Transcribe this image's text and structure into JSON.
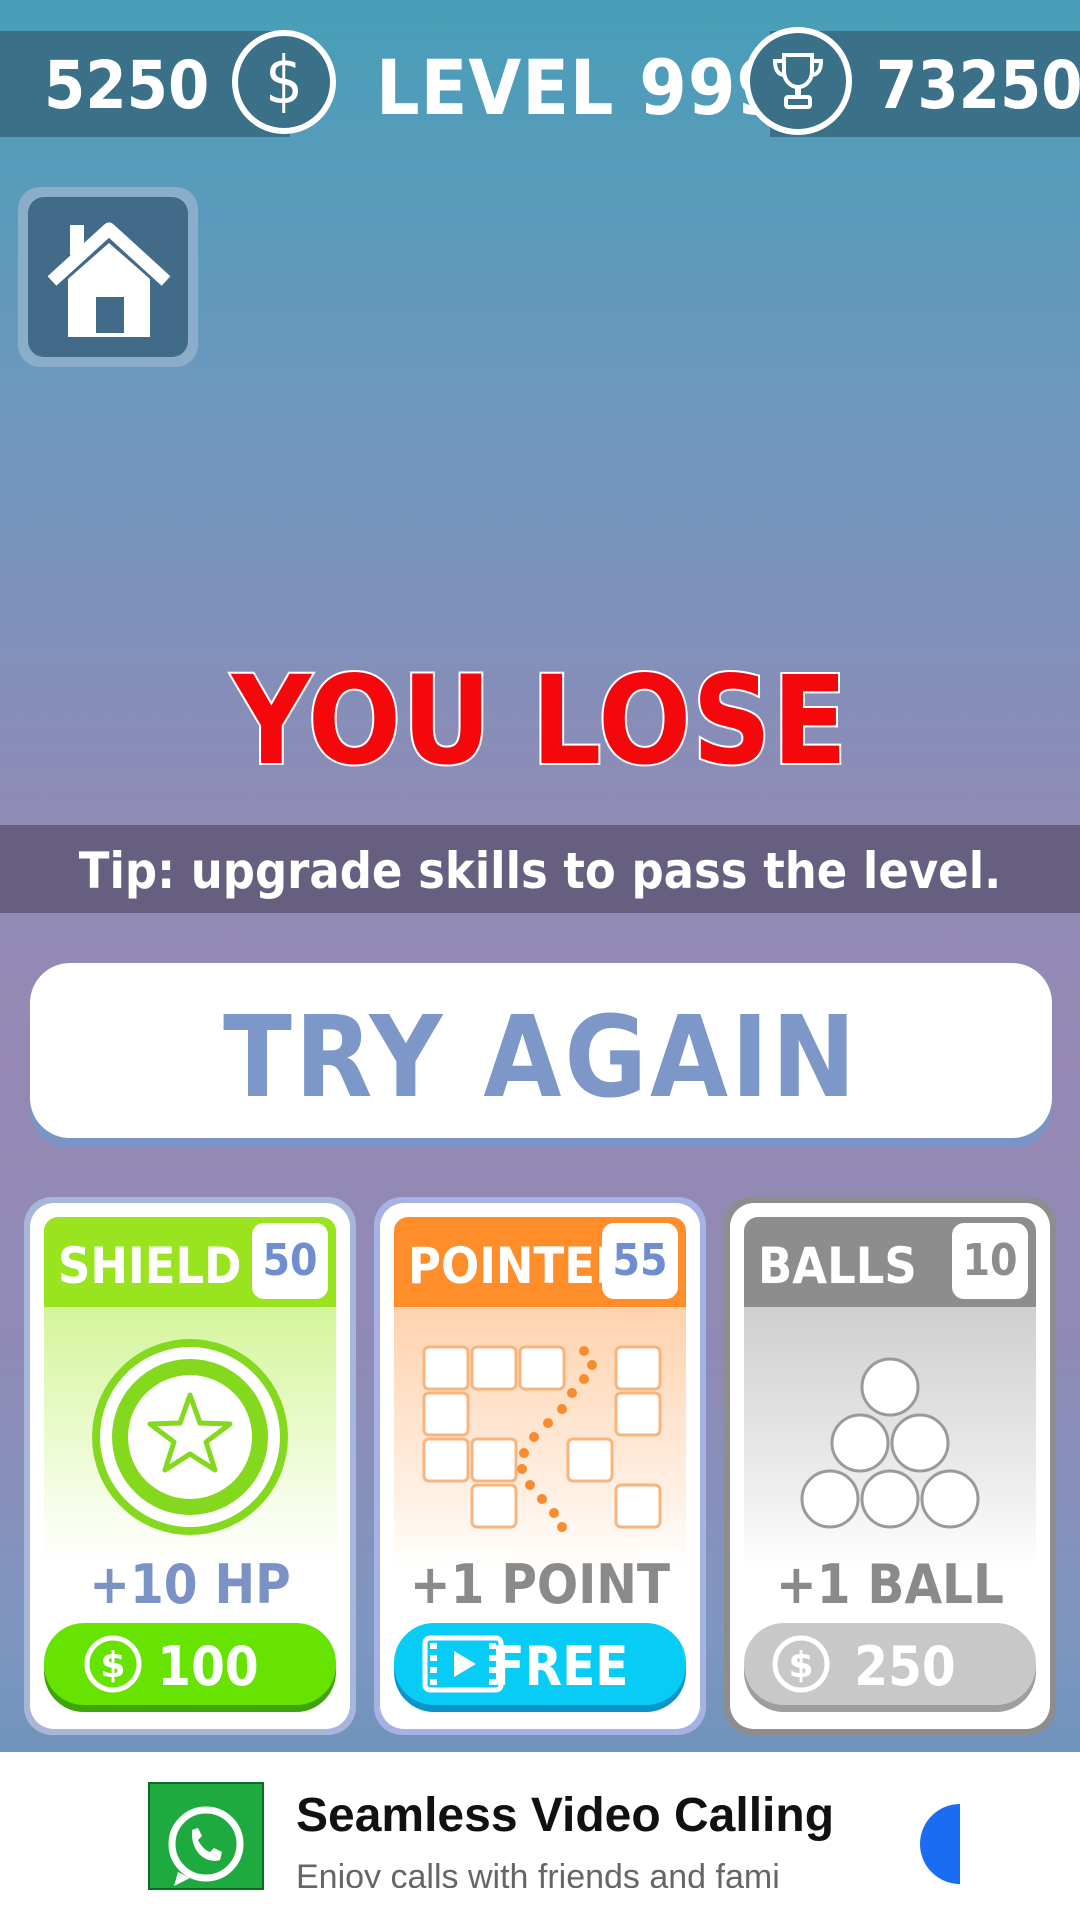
{
  "hud": {
    "coins": "5250",
    "coin_symbol": "$",
    "level": "LEVEL 999",
    "score": "73250"
  },
  "result": {
    "title": "YOU LOSE",
    "tip": "Tip: upgrade skills to pass the level."
  },
  "try_again": "TRY AGAIN",
  "skills": [
    {
      "name": "SHIELD",
      "level": "50",
      "gain": "+10 HP",
      "price": "100",
      "color": "#8fe11b"
    },
    {
      "name": "POINTER",
      "level": "55",
      "gain": "+1 POINT",
      "price": "FREE",
      "color": "#ff8e2a"
    },
    {
      "name": "BALLS",
      "level": "10",
      "gain": "+1 BALL",
      "price": "250",
      "color": "#8d8d8d"
    }
  ],
  "ad": {
    "title": "Seamless Video Calling",
    "subtitle": "Enjoy calls with friends and fami"
  }
}
